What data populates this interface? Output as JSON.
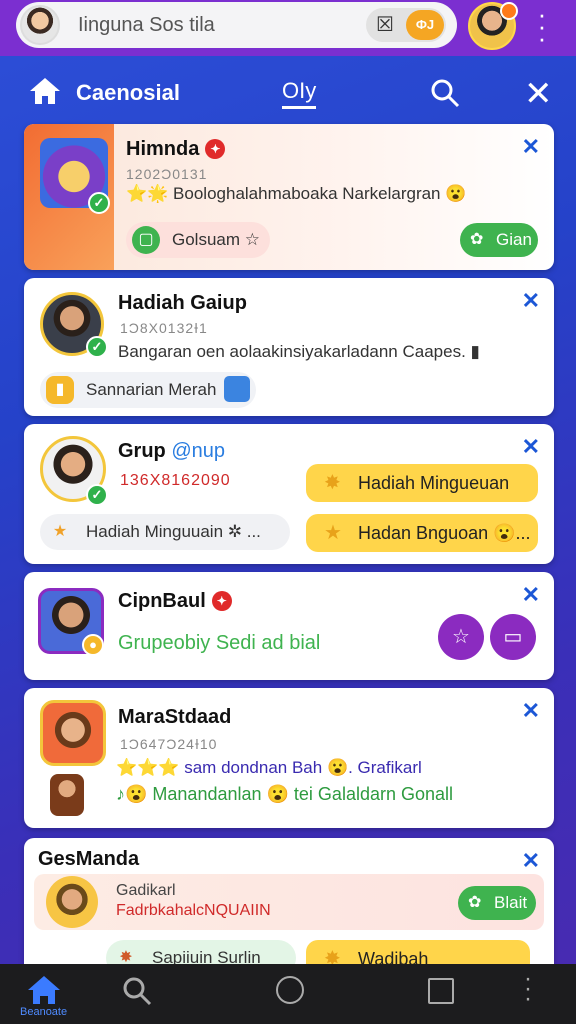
{
  "topbar": {
    "search_text": "Iinguna Sos tila",
    "toggle_x": "☒",
    "toggle_knob": "ФЈ"
  },
  "nav": {
    "title": "Caenosial",
    "mid_tab": "OIy"
  },
  "cards": [
    {
      "name": "Himnda",
      "meta": "1202Ɔ0131",
      "line": "⭐🌟 Boologhalahmaboaka Narkelargran 😮",
      "chip": "Golsuam ☆",
      "button": "Gian"
    },
    {
      "name": "Hadiah Gaiup",
      "meta": "1Ɔ8X0132Ɨ1",
      "line": "Bangaran oen aolaakinsiyakarladann Caapes. ▮",
      "chip": "Sannarian Merah"
    },
    {
      "name": "Grup",
      "name_tag": "@nup",
      "meta": "136X8162090",
      "chip": "Hadiah Minguuain ✲ ...",
      "yellow1": "Hadiah Mingueuan",
      "yellow2": "Hadan Bnguoan 😮..."
    },
    {
      "name": "CipnBaul",
      "line": "Grupeobiy Sedi ad bial"
    },
    {
      "name": "MaraStdaad",
      "meta": "1Ɔ647Ɔ24Ɨ10",
      "line1": "⭐⭐⭐ sam dondnan Bah 😮. Grafikarl",
      "line2": "♪😮 Manandanlan 😮 tei Galaldarn Gonall"
    },
    {
      "name": "GesManda",
      "sub1": "Gadikarl",
      "sub2": "FadrbkahalcNQUAIIN",
      "button": "Blait",
      "chip1": "Sapiiuin Surlin",
      "chip2": "Wadibah"
    }
  ],
  "bottomnav": {
    "home_label": "Beanoate"
  },
  "colors": {
    "topbar": "#7b2fd0",
    "accent_blue": "#1c57d6",
    "green": "#3fb34f",
    "yellow": "#ffd54a",
    "purple": "#8b2bc0"
  }
}
